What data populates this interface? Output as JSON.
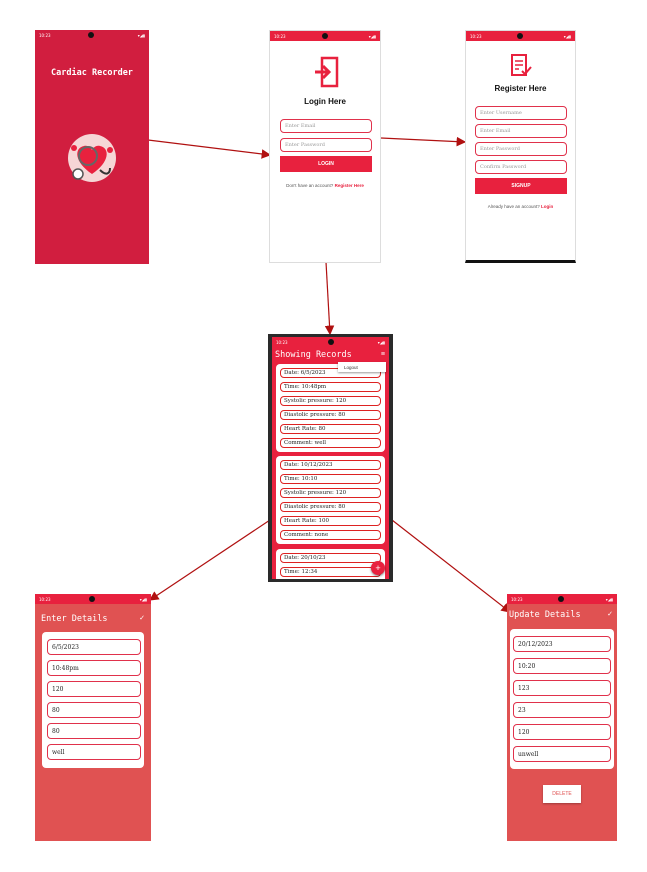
{
  "colors": {
    "red": "#d11e3f",
    "accent": "#e8213e",
    "coral": "#e05252",
    "arrow": "#b01010"
  },
  "status": {
    "time": "10:23",
    "icons": "▾◢▮"
  },
  "splash": {
    "title": "Cardiac Recorder"
  },
  "login": {
    "title": "Login Here",
    "email_ph": "Enter Email",
    "password_ph": "Enter Password",
    "button": "LOGIN",
    "footer": "Don't have an account?",
    "footer_link": "Register Here"
  },
  "register": {
    "title": "Register Here",
    "username_ph": "Enter Username",
    "email_ph": "Enter Email",
    "password_ph": "Enter Password",
    "confirm_ph": "Confirm Password",
    "button": "SIGNUP",
    "footer": "Already have an account?",
    "footer_link": "Login"
  },
  "records": {
    "title": "Showing Records",
    "menu_item": "Logout",
    "fab": "+",
    "card1": [
      "Date:  6/5/2023",
      "Time:  10:48pm",
      "Systolic pressure:  120",
      "Diastolic pressure:  80",
      "Heart Rate:  80",
      "Comment:  well"
    ],
    "card2": [
      "Date:  10/12/2023",
      "Time:  10:10",
      "Systolic pressure:  120",
      "Diastolic pressure:  80",
      "Heart Rate:  100",
      "Comment:  none"
    ],
    "card3": [
      "Date:  20/10/23",
      "Time:  12:34"
    ]
  },
  "enter": {
    "title": "Enter Details",
    "check": "✓",
    "fields": [
      "6/5/2023",
      "10:48pm",
      "120",
      "80",
      "80",
      "well"
    ]
  },
  "update": {
    "title": "Update Details",
    "check": "✓",
    "fields": [
      "20/12/2023",
      "10:20",
      "123",
      "23",
      "120",
      "unwell"
    ],
    "delete": "DELETE"
  }
}
